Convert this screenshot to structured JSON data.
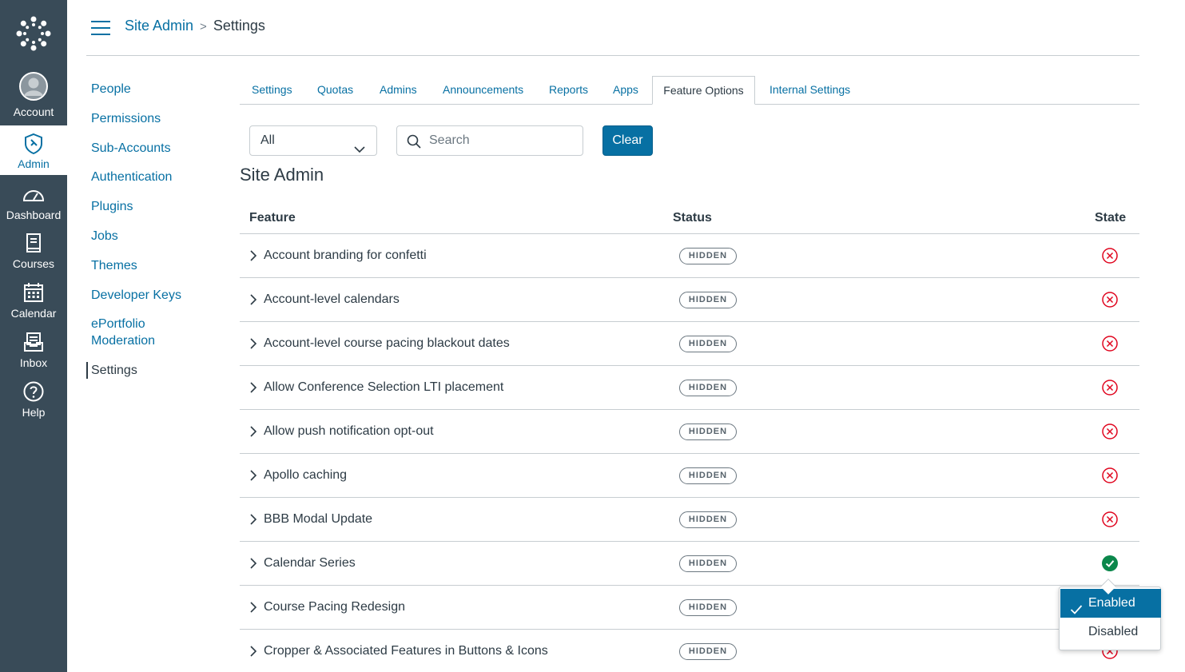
{
  "global_nav": {
    "account_label": "Account",
    "admin_label": "Admin",
    "dashboard_label": "Dashboard",
    "courses_label": "Courses",
    "calendar_label": "Calendar",
    "inbox_label": "Inbox",
    "help_label": "Help"
  },
  "breadcrumb": {
    "parent": "Site Admin",
    "separator": ">",
    "current": "Settings"
  },
  "sidebar": {
    "items": [
      {
        "label": "People"
      },
      {
        "label": "Permissions"
      },
      {
        "label": "Sub-Accounts"
      },
      {
        "label": "Authentication"
      },
      {
        "label": "Plugins"
      },
      {
        "label": "Jobs"
      },
      {
        "label": "Themes"
      },
      {
        "label": "Developer Keys"
      },
      {
        "label": "ePortfolio"
      },
      {
        "label": "Moderation"
      },
      {
        "label": "Settings"
      }
    ]
  },
  "tabs": [
    {
      "label": "Settings"
    },
    {
      "label": "Quotas"
    },
    {
      "label": "Admins"
    },
    {
      "label": "Announcements"
    },
    {
      "label": "Reports"
    },
    {
      "label": "Apps"
    },
    {
      "label": "Feature Options",
      "active": true
    },
    {
      "label": "Internal Settings"
    }
  ],
  "filters": {
    "select_value": "All",
    "search_placeholder": "Search",
    "clear_label": "Clear"
  },
  "section_title": "Site Admin",
  "table": {
    "headers": {
      "feature": "Feature",
      "status": "Status",
      "state": "State"
    },
    "rows": [
      {
        "name": "Account branding for confetti",
        "status": "HIDDEN",
        "state": "disabled"
      },
      {
        "name": "Account-level calendars",
        "status": "HIDDEN",
        "state": "disabled"
      },
      {
        "name": "Account-level course pacing blackout dates",
        "status": "HIDDEN",
        "state": "disabled"
      },
      {
        "name": "Allow Conference Selection LTI placement",
        "status": "HIDDEN",
        "state": "disabled"
      },
      {
        "name": "Allow push notification opt-out",
        "status": "HIDDEN",
        "state": "disabled"
      },
      {
        "name": "Apollo caching",
        "status": "HIDDEN",
        "state": "disabled"
      },
      {
        "name": "BBB Modal Update",
        "status": "HIDDEN",
        "state": "disabled"
      },
      {
        "name": "Calendar Series",
        "status": "HIDDEN",
        "state": "enabled"
      },
      {
        "name": "Course Pacing Redesign",
        "status": "HIDDEN",
        "state": "disabled"
      },
      {
        "name": "Cropper & Associated Features in Buttons & Icons",
        "status": "HIDDEN",
        "state": "disabled"
      }
    ]
  },
  "state_menu": {
    "enabled_label": "Enabled",
    "disabled_label": "Disabled",
    "selected": "Enabled"
  },
  "colors": {
    "nav_bg": "#394b58",
    "link": "#0770a3",
    "enabled": "#0b874b",
    "disabled": "#e0061f"
  },
  "icons": {
    "menu": "hamburger-icon",
    "expand": "chevron-right-icon",
    "disabled_state": "x-circle-icon",
    "enabled_state": "check-circle-icon"
  }
}
